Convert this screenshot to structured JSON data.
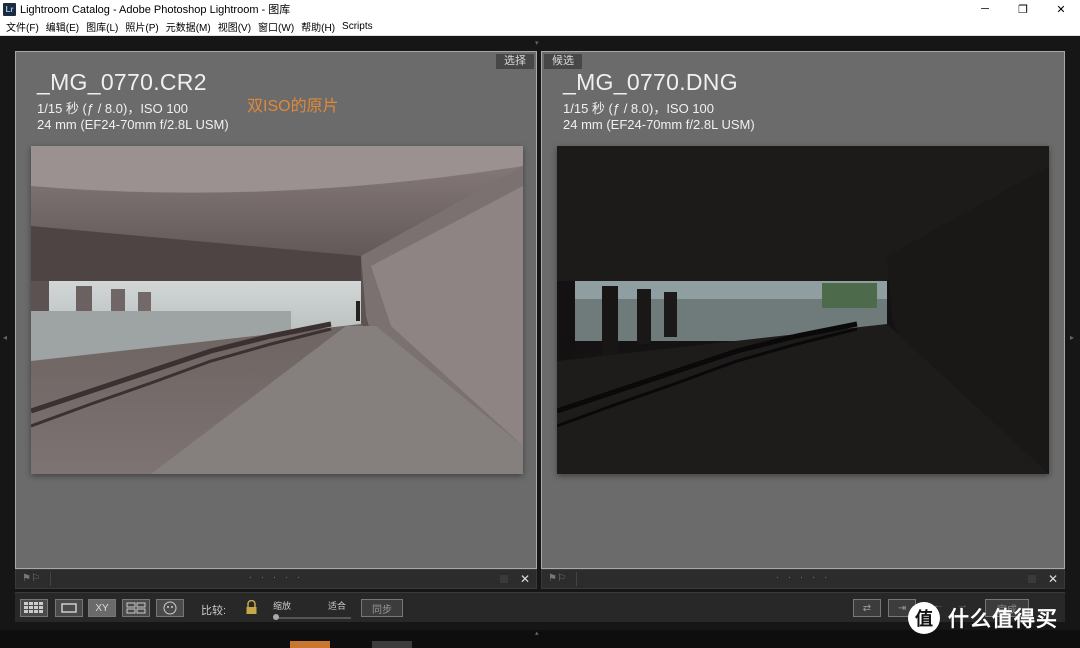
{
  "window": {
    "app_icon_text": "Lr",
    "title": "Lightroom Catalog - Adobe Photoshop Lightroom - 图库",
    "controls": [
      "─",
      "❐",
      "✕"
    ]
  },
  "menu": [
    "文件(F)",
    "编辑(E)",
    "图库(L)",
    "照片(P)",
    "元数据(M)",
    "视图(V)",
    "窗口(W)",
    "帮助(H)",
    "Scripts"
  ],
  "compare": {
    "left": {
      "tag": "选择",
      "filename": "_MG_0770.CR2",
      "exif_line1": "1/15 秒 (ƒ / 8.0)，ISO 100",
      "exif_line2": "24 mm (EF24-70mm f/2.8L USM)",
      "annotation": "双ISO的原片",
      "annotation_color": "#e0883a"
    },
    "right": {
      "tag": "候选",
      "filename": "_MG_0770.DNG",
      "exif_line1": "1/15 秒 (ƒ / 8.0)，ISO 100",
      "exif_line2": "24 mm (EF24-70mm f/2.8L USM)"
    }
  },
  "footer": {
    "dots": "· · · · ·",
    "close": "✕"
  },
  "toolbar": {
    "compare_label": "比较:",
    "zoom_label": "缩放",
    "fit_label": "适合",
    "sync_label": "同步",
    "xy_label": "XY",
    "done_label": "完成"
  },
  "watermark": {
    "logo_glyph": "值",
    "text": "什么值得买"
  }
}
